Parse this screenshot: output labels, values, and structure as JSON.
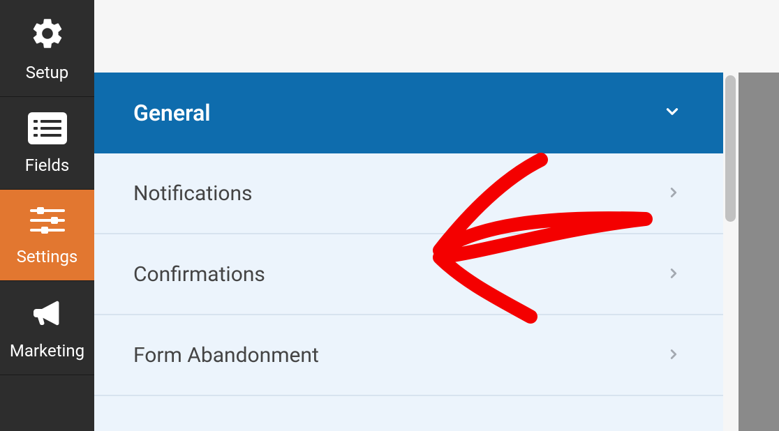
{
  "sidebar": {
    "items": [
      {
        "label": "Setup"
      },
      {
        "label": "Fields"
      },
      {
        "label": "Settings"
      },
      {
        "label": "Marketing"
      }
    ]
  },
  "panel": {
    "header": "General",
    "rows": [
      {
        "label": "Notifications"
      },
      {
        "label": "Confirmations"
      },
      {
        "label": "Form Abandonment"
      }
    ]
  }
}
